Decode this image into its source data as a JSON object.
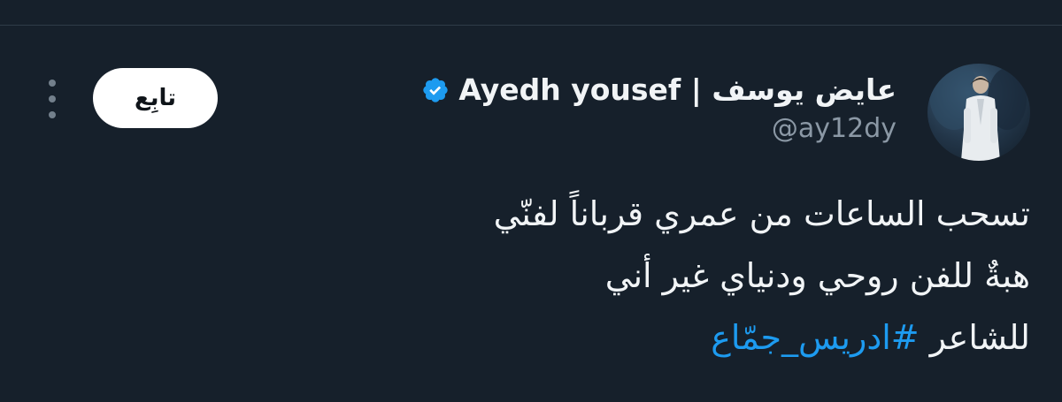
{
  "author": {
    "display_name": "عايض يوسف | Ayedh yousef",
    "handle": "@ay12dy",
    "verified": true
  },
  "actions": {
    "follow_label": "تابِع"
  },
  "tweet": {
    "line1": "تسحب الساعات من عمري قرباناً لفنّي",
    "line2": "هبةٌ للفن روحي ودنياي غير أني",
    "line3_prefix": "للشاعر ",
    "hashtag": "#ادريس_جمّاع"
  },
  "colors": {
    "background": "#16202b",
    "text": "#f1f4f6",
    "secondary_text": "#8b98a5",
    "accent": "#1d9bf0",
    "follow_button_bg": "#ffffff"
  },
  "icons": {
    "verified": "verified-badge-icon",
    "more": "more-vertical-icon"
  }
}
